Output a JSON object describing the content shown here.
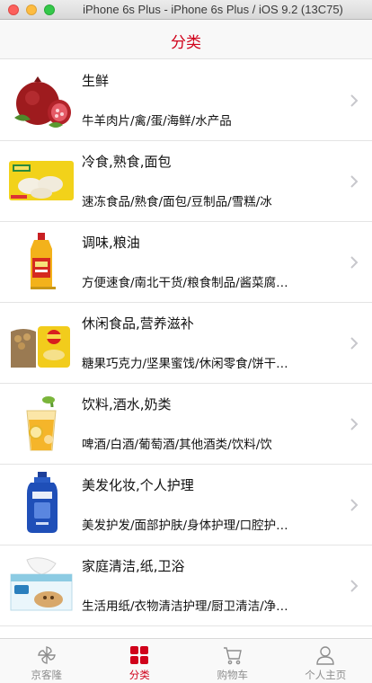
{
  "window": {
    "title": "iPhone 6s Plus - iPhone 6s Plus / iOS 9.2 (13C75)"
  },
  "navbar": {
    "title": "分类"
  },
  "categories": [
    {
      "title": "生鲜",
      "subtitle": "牛羊肉片/禽/蛋/海鲜/水产品",
      "icon": "pomegranate-icon"
    },
    {
      "title": "冷食,熟食,面包",
      "subtitle": "速冻食品/熟食/面包/豆制品/雪糕/冰",
      "icon": "frozen-food-icon"
    },
    {
      "title": "调味,粮油",
      "subtitle": "方便速食/南北干货/粮食制品/酱菜腐…",
      "icon": "cooking-oil-icon"
    },
    {
      "title": "休闲食品,营养滋补",
      "subtitle": "糖果巧克力/坚果蜜饯/休闲零食/饼干…",
      "icon": "snacks-icon"
    },
    {
      "title": "饮料,酒水,奶类",
      "subtitle": "啤酒/白酒/葡萄酒/其他酒类/饮料/饮",
      "icon": "drink-icon"
    },
    {
      "title": "美发化妆,个人护理",
      "subtitle": "美发护发/面部护肤/身体护理/口腔护…",
      "icon": "shampoo-icon"
    },
    {
      "title": "家庭清洁,纸,卫浴",
      "subtitle": "生活用纸/衣物清洁护理/厨卫清洁/净…",
      "icon": "tissue-box-icon"
    }
  ],
  "tabbar": {
    "tabs": [
      {
        "label": "京客隆",
        "icon": "pinwheel-icon"
      },
      {
        "label": "分类",
        "icon": "grid-icon"
      },
      {
        "label": "购物车",
        "icon": "cart-icon"
      },
      {
        "label": "个人主页",
        "icon": "person-icon"
      }
    ],
    "active": "分类",
    "active_color": "#d0021b",
    "inactive_color": "#8e8e8e"
  },
  "colors": {
    "accent": "#d0021b"
  }
}
